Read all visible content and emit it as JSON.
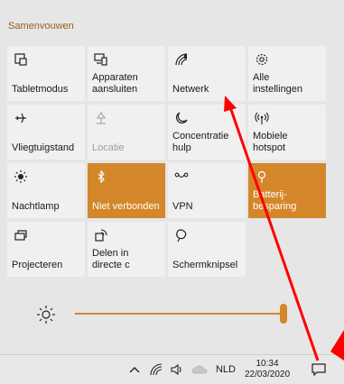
{
  "header": {
    "collapse_label": "Samenvouwen"
  },
  "tiles": [
    {
      "label": "Tabletmodus",
      "icon": "tablet-mode-icon",
      "state": "normal"
    },
    {
      "label": "Apparaten\naansluiten",
      "icon": "connect-icon",
      "state": "normal"
    },
    {
      "label": "Netwerk",
      "icon": "network-icon",
      "state": "normal"
    },
    {
      "label": "Alle\ninstellingen",
      "icon": "gear-icon",
      "state": "normal"
    },
    {
      "label": "Vliegtuigstand",
      "icon": "airplane-icon",
      "state": "normal"
    },
    {
      "label": "Locatie",
      "icon": "location-icon",
      "state": "disabled"
    },
    {
      "label": "Concentratie\nhulp",
      "icon": "moon-icon",
      "state": "normal"
    },
    {
      "label": "Mobiele\nhotspot",
      "icon": "hotspot-icon",
      "state": "normal"
    },
    {
      "label": "Nachtlamp",
      "icon": "sun-icon",
      "state": "normal"
    },
    {
      "label": "Niet verbonden",
      "icon": "bluetooth-icon",
      "state": "active"
    },
    {
      "label": "VPN",
      "icon": "vpn-icon",
      "state": "normal"
    },
    {
      "label": "Batterij-\nbesparing",
      "icon": "battery-saver-icon",
      "state": "active"
    },
    {
      "label": "Projecteren",
      "icon": "project-icon",
      "state": "normal"
    },
    {
      "label": "Delen in\ndirecte c",
      "icon": "share-icon",
      "state": "normal"
    },
    {
      "label": "Schermknipsel",
      "icon": "snip-icon",
      "state": "normal"
    }
  ],
  "brightness": {
    "level": 0.98,
    "icon": "brightness-icon"
  },
  "taskbar": {
    "language": "NLD",
    "time": "10:34",
    "date": "22/03/2020",
    "icons": [
      "chevron-up-icon",
      "wifi-icon",
      "volume-icon",
      "onedrive-icon",
      "action-center-icon"
    ]
  },
  "colors": {
    "accent": "#d4862a",
    "tile_bg": "#f0f0f0",
    "panel_bg": "#e6e6e6",
    "annotation": "#ff0000"
  }
}
